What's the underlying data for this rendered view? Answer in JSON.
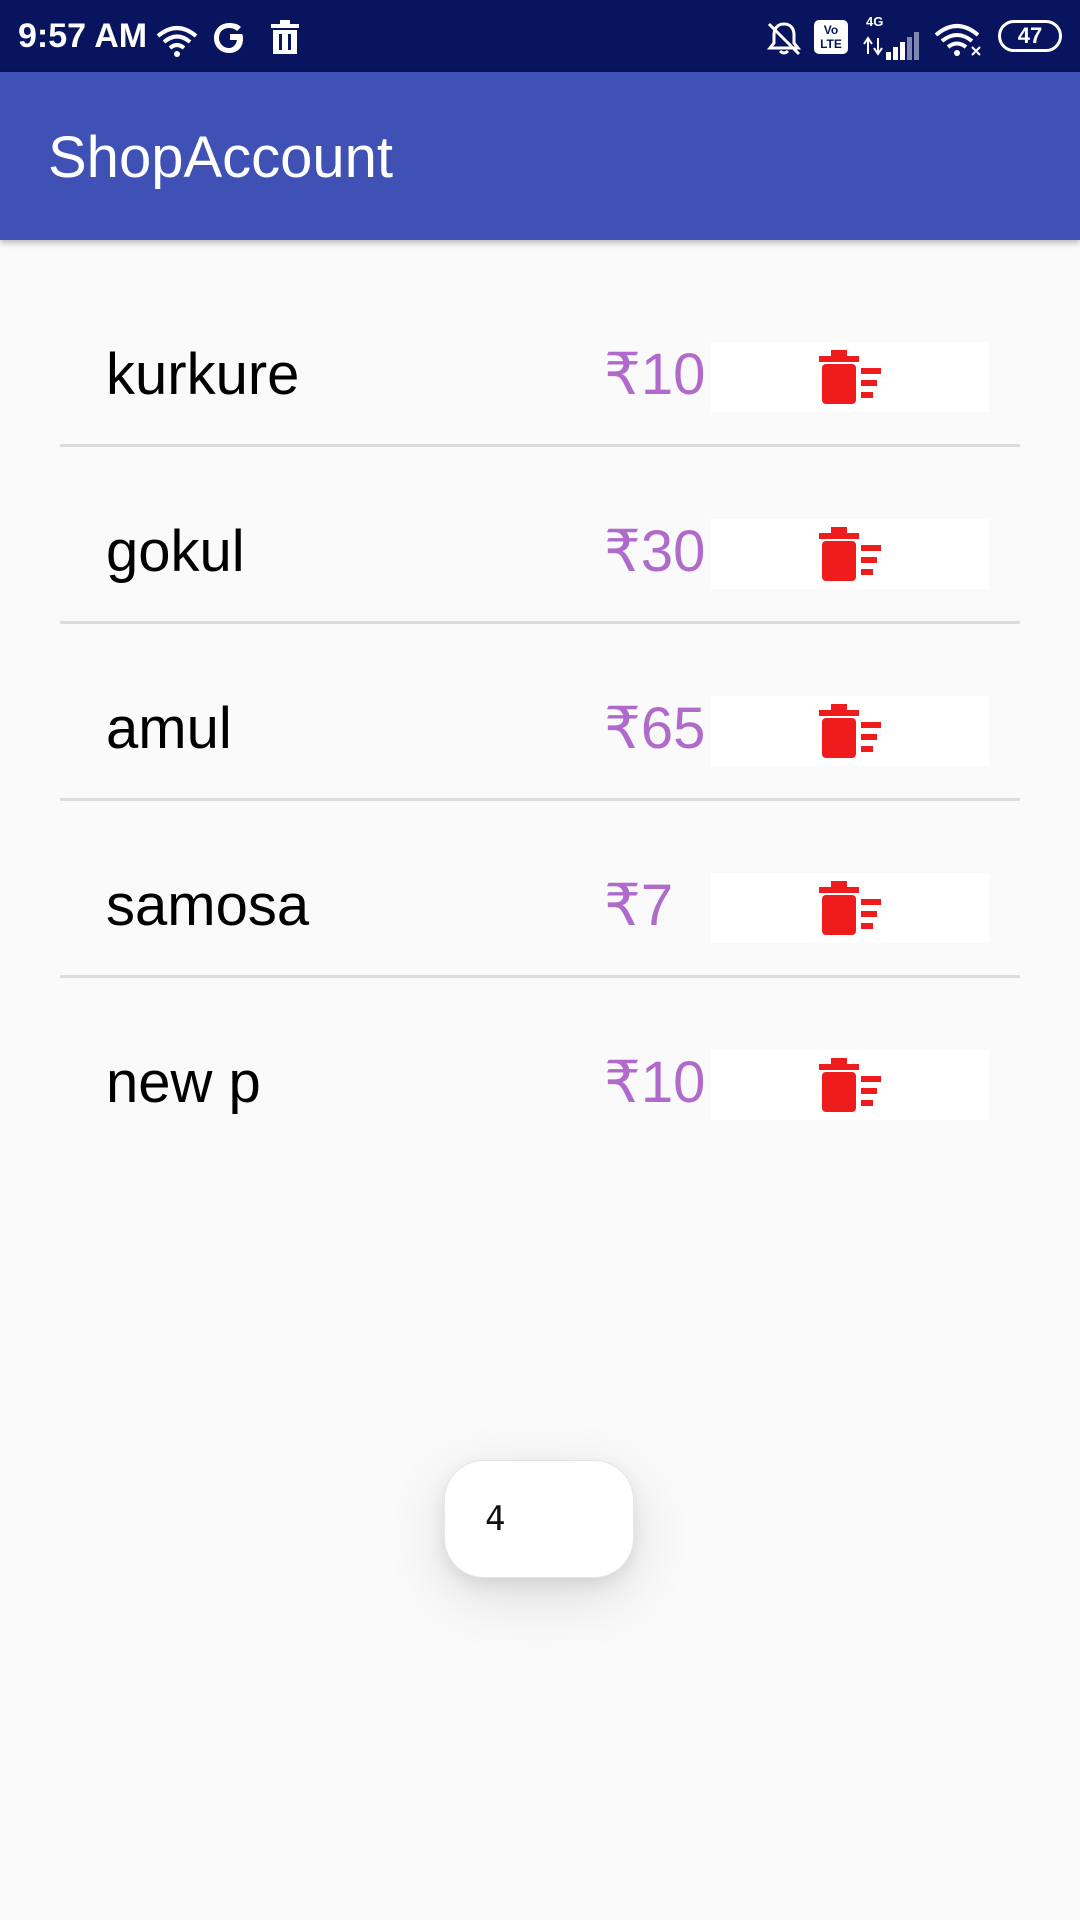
{
  "status_bar": {
    "time": "9:57 AM",
    "network_badge": "Vo LTE",
    "network_type": "4G",
    "battery": "47",
    "left_icons": [
      "wifi-icon",
      "google-icon",
      "trash-icon"
    ],
    "right_icons": [
      "mute-icon",
      "volte-icon",
      "signal-icon",
      "wifi-icon",
      "battery-icon"
    ]
  },
  "app_bar": {
    "title": "ShopAccount"
  },
  "items": [
    {
      "name": "kurkure",
      "price": "₹10"
    },
    {
      "name": "gokul",
      "price": "₹30"
    },
    {
      "name": "amul",
      "price": "₹65"
    },
    {
      "name": "samosa",
      "price": "₹7"
    },
    {
      "name": "new p",
      "price": "₹10"
    }
  ],
  "icons": {
    "delete": "delete-sweep-icon"
  },
  "toast": {
    "text": "4"
  },
  "colors": {
    "status_bar": "#08155e",
    "app_bar": "#3f51b5",
    "price": "#b06acb",
    "delete_icon": "#ee1c1c",
    "background": "#fafafa"
  }
}
